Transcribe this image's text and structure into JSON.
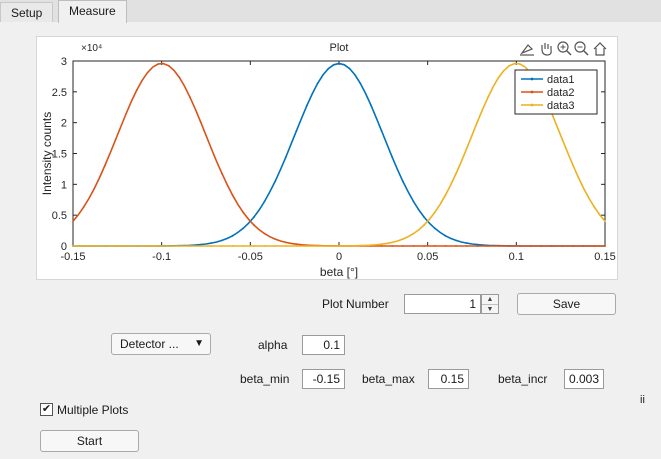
{
  "tabs": [
    {
      "label": "Setup"
    },
    {
      "label": "Measure"
    }
  ],
  "plot": {
    "title": "Plot",
    "toolbar_icons": [
      "data-tips-icon",
      "pan-icon",
      "zoom-in-icon",
      "zoom-out-icon",
      "home-icon"
    ]
  },
  "chart_data": {
    "type": "line",
    "title": "Plot",
    "xlabel": "beta [°]",
    "ylabel": "Intensity counts",
    "y_exponent": "×10⁴",
    "xlim": [
      -0.15,
      0.15
    ],
    "ylim": [
      0,
      3
    ],
    "xticks": [
      "-0.15",
      "-0.1",
      "-0.05",
      "0",
      "0.05",
      "0.1",
      "0.15"
    ],
    "yticks": [
      "0",
      "0.5",
      "1",
      "1.5",
      "2",
      "2.5",
      "3"
    ],
    "legend_position": "top-right",
    "series": [
      {
        "name": "data1",
        "color": "#0072bd",
        "center": 0,
        "peak": 2.96,
        "sigma": 0.025
      },
      {
        "name": "data2",
        "color": "#d95319",
        "center": -0.1,
        "peak": 2.96,
        "sigma": 0.025
      },
      {
        "name": "data3",
        "color": "#edb120",
        "center": 0.1,
        "peak": 2.96,
        "sigma": 0.025
      }
    ]
  },
  "controls": {
    "plot_number_label": "Plot Number",
    "plot_number_value": "1",
    "save_label": "Save",
    "detector_label": "Detector ...",
    "alpha_label": "alpha",
    "alpha_value": "0.1",
    "beta_min_label": "beta_min",
    "beta_min_value": "-0.15",
    "beta_max_label": "beta_max",
    "beta_max_value": "0.15",
    "beta_incr_label": "beta_incr",
    "beta_incr_value": "0.003",
    "multiple_plots_label": "Multiple Plots",
    "multiple_plots_checked": true,
    "start_label": "Start",
    "side_indicator": "ii"
  }
}
